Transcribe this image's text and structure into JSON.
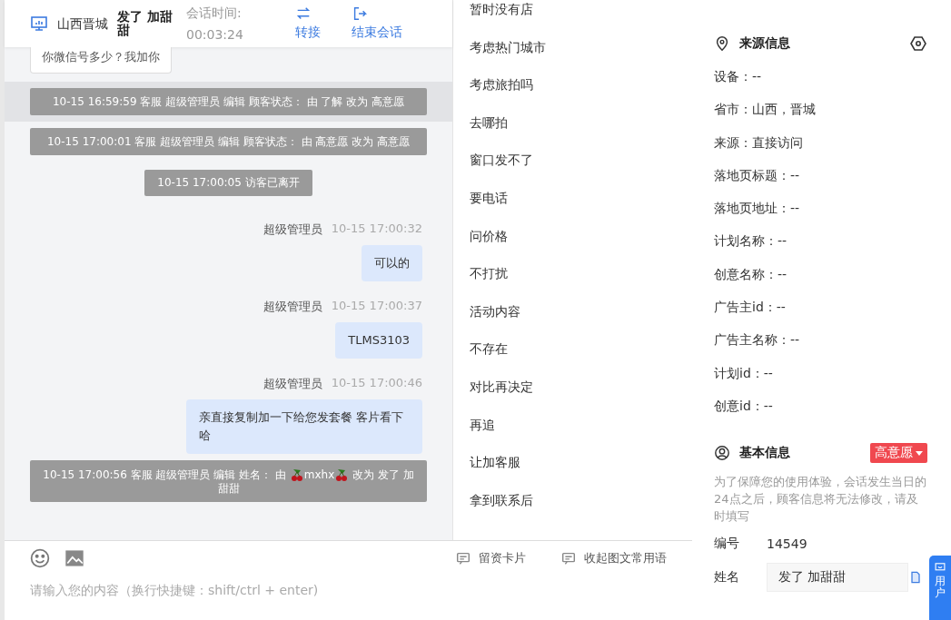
{
  "header": {
    "city": "山西晋城",
    "name": "发了 加甜甜",
    "time_label": "会话时间:",
    "time": "00:03:24",
    "actions": [
      {
        "kind": "transfer",
        "label": "转接"
      },
      {
        "kind": "end",
        "label": "结束会话"
      }
    ]
  },
  "messages": [
    {
      "kind": "visitor",
      "text": "你微信号多少？我加你"
    },
    {
      "kind": "system",
      "highlight": true,
      "parts": [
        {
          "kind": "text",
          "text": "10-15 16:59:59 客服 超级管理员 编辑 顾客状态： 由 了解 改为 高意愿"
        }
      ]
    },
    {
      "kind": "system",
      "highlight": false,
      "parts": [
        {
          "kind": "text",
          "text": "10-15 17:00:01 客服 超级管理员 编辑 顾客状态： 由 高意愿 改为 高意愿"
        }
      ]
    },
    {
      "kind": "notice",
      "text": "10-15 17:00:05 访客已离开"
    },
    {
      "kind": "agent",
      "author": "超级管理员",
      "time": "10-15 17:00:32",
      "text": "可以的"
    },
    {
      "kind": "agent",
      "author": "超级管理员",
      "time": "10-15 17:00:37",
      "text": "TLMS3103"
    },
    {
      "kind": "agent",
      "author": "超级管理员",
      "time": "10-15 17:00:46",
      "text": "亲直接复制加一下给您发套餐 客片看下哈"
    },
    {
      "kind": "system",
      "highlight": false,
      "parts": [
        {
          "kind": "text",
          "text": "10-15 17:00:56 客服 超级管理员 编辑 姓名： 由 "
        },
        {
          "kind": "cherry"
        },
        {
          "kind": "text",
          "text": "mxhx"
        },
        {
          "kind": "cherry"
        },
        {
          "kind": "text",
          "text": " 改为 发了 加甜甜"
        }
      ]
    }
  ],
  "input": {
    "placeholder": "请输入您的内容（换行快捷键：shift/ctrl + enter)",
    "tools": [
      {
        "kind": "emoji"
      },
      {
        "kind": "image"
      }
    ],
    "links": [
      "留资卡片",
      "收起图文常用语"
    ]
  },
  "phrases": [
    "暂时没有店",
    "考虑热门城市",
    "考虑旅拍吗",
    "去哪拍",
    "窗口发不了",
    "要电话",
    "问价格",
    "不打扰",
    "活动内容",
    "不存在",
    "对比再决定",
    "再追",
    "让加客服",
    "拿到联系后"
  ],
  "source": {
    "title": "来源信息",
    "rows": [
      "设备：--",
      "省市：山西，晋城",
      "来源：直接访问",
      "落地页标题：--",
      "落地页地址：--",
      "计划名称：--",
      "创意名称：--",
      "广告主id：--",
      "广告主名称：--",
      "计划id：--",
      "创意id：--"
    ]
  },
  "basic": {
    "title": "基本信息",
    "status": "高意愿",
    "note": "为了保障您的使用体验，会话发生当日的24点之后，顾客信息将无法修改，请及时填写",
    "fields": [
      {
        "kind": "text",
        "label": "编号",
        "value": "14549"
      },
      {
        "kind": "input",
        "label": "姓名",
        "value": "发了 加甜甜"
      }
    ]
  },
  "float_tab": {
    "label": "用户"
  }
}
